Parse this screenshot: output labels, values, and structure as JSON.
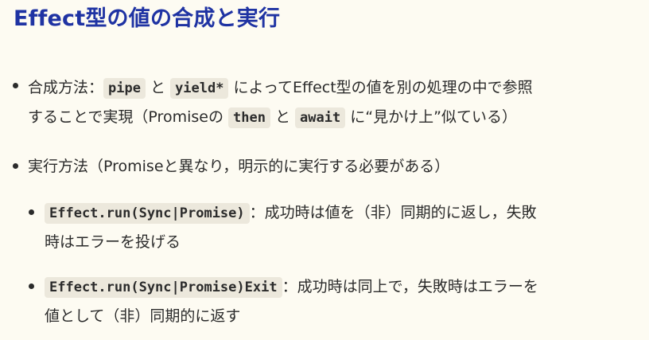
{
  "slide": {
    "title": "Effect型の値の合成と実行",
    "bullets": [
      {
        "line1_pre": "合成方法：",
        "code1": "pipe",
        "mid1": " と ",
        "code2": "yield*",
        "line1_post": " によってEffect型の値を別の処理の中で参照",
        "line2_pre": "することで実現（Promiseの ",
        "code3": "then",
        "mid2": " と ",
        "code4": "await",
        "line2_post": " に“見かけ上”似ている）"
      },
      {
        "text": "実行方法（Promiseと異なり，明示的に実行する必要がある）"
      }
    ],
    "subbullets": [
      {
        "code": "Effect.run(Sync|Promise)",
        "line1_post": "：成功時は値を（非）同期的に返し，失敗",
        "line2": "時はエラーを投げる"
      },
      {
        "code": "Effect.run(Sync|Promise)Exit",
        "line1_post": "：成功時は同上で，失敗時はエラーを",
        "line2": "値として（非）同期的に返す"
      }
    ]
  }
}
